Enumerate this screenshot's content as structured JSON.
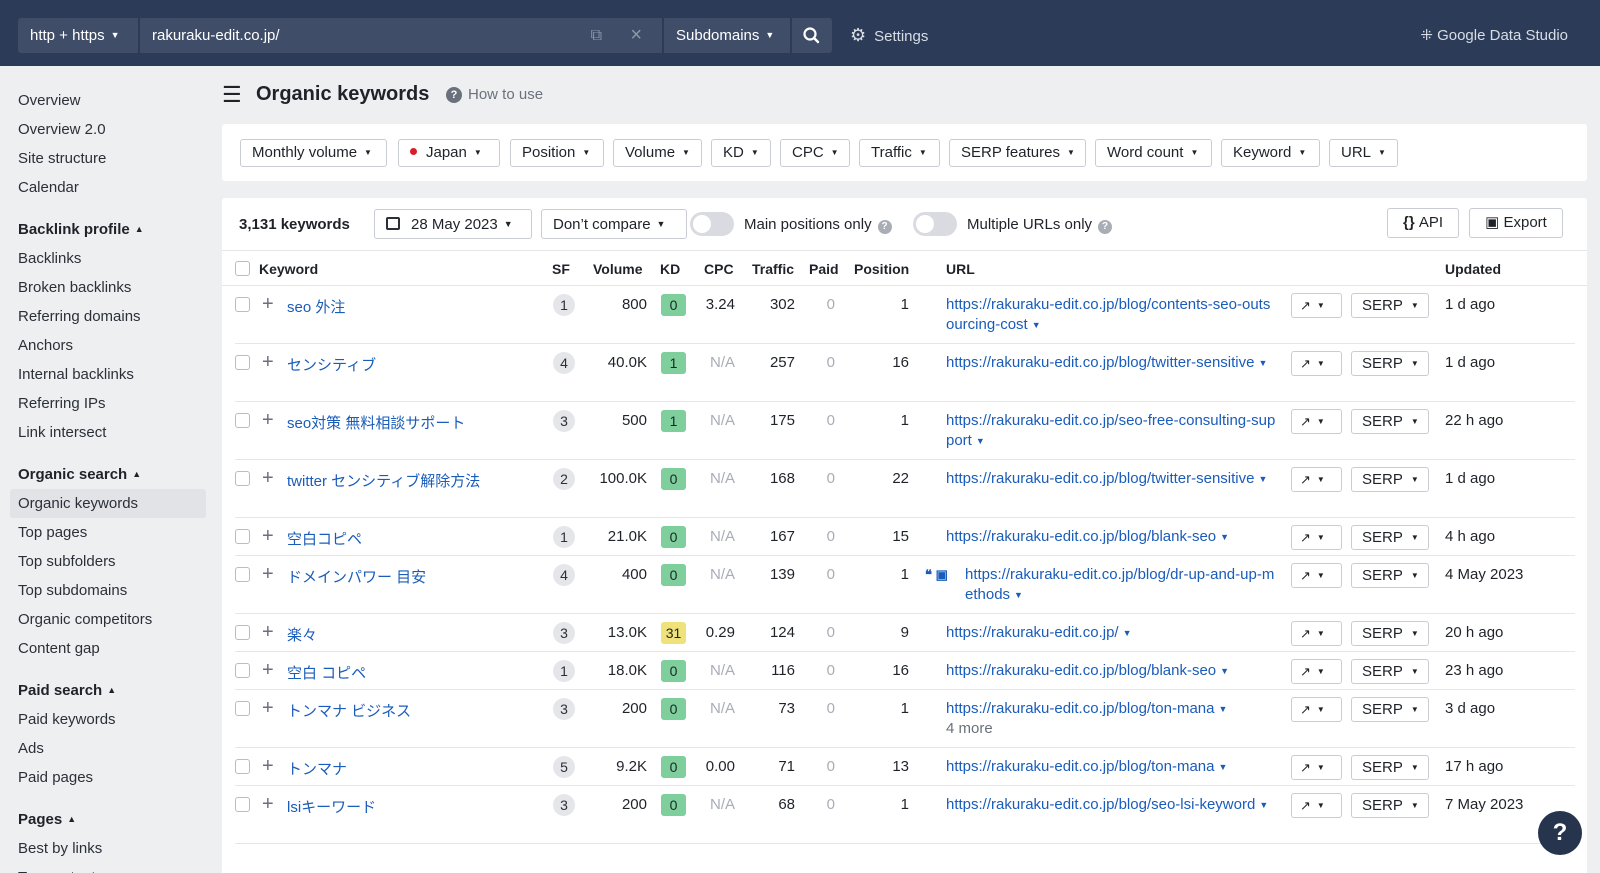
{
  "topbar": {
    "protocol": "http + https",
    "url": "rakuraku-edit.co.jp/",
    "mode": "Subdomains",
    "settings": "Settings",
    "gds": "Google Data Studio"
  },
  "sidebar": {
    "items_top": [
      "Overview",
      "Overview 2.0",
      "Site structure",
      "Calendar"
    ],
    "backlink_title": "Backlink profile",
    "backlink_items": [
      "Backlinks",
      "Broken backlinks",
      "Referring domains",
      "Anchors",
      "Internal backlinks",
      "Referring IPs",
      "Link intersect"
    ],
    "organic_title": "Organic search",
    "organic_items": [
      "Organic keywords",
      "Top pages",
      "Top subfolders",
      "Top subdomains",
      "Organic competitors",
      "Content gap"
    ],
    "paid_title": "Paid search",
    "paid_items": [
      "Paid keywords",
      "Ads",
      "Paid pages"
    ],
    "pages_title": "Pages",
    "pages_items": [
      "Best by links",
      "Top content"
    ]
  },
  "header": {
    "title": "Organic keywords",
    "how_to": "How to use"
  },
  "filters": [
    "Monthly volume",
    "Japan",
    "Position",
    "Volume",
    "KD",
    "CPC",
    "Traffic",
    "SERP features",
    "Word count",
    "Keyword",
    "URL"
  ],
  "toolbar": {
    "count": "3,131 keywords",
    "date": "28 May 2023",
    "compare": "Don’t compare",
    "main_positions": "Main positions only",
    "multiple_urls": "Multiple URLs only",
    "api": "API",
    "export": "Export"
  },
  "columns": [
    "Keyword",
    "SF",
    "Volume",
    "KD",
    "CPC",
    "Traffic",
    "Paid",
    "Position",
    "URL",
    "Updated"
  ],
  "rows": [
    {
      "kw": "seo 外注",
      "sf": "1",
      "vol": "800",
      "kd": "0",
      "kdc": "g",
      "cpc": "3.24",
      "traffic": "302",
      "paid": "0",
      "pos": "1",
      "url": "https://rakuraku-edit.co.jp/blog/contents-seo-outsourcing-cost",
      "more": "",
      "upd": "1 d ago"
    },
    {
      "kw": "センシティブ",
      "sf": "4",
      "vol": "40.0K",
      "kd": "1",
      "kdc": "g",
      "cpc": "N/A",
      "traffic": "257",
      "paid": "0",
      "pos": "16",
      "url": "https://rakuraku-edit.co.jp/blog/twitter-sensitive",
      "more": "",
      "upd": "1 d ago"
    },
    {
      "kw": "seo対策 無料相談サポート",
      "sf": "3",
      "vol": "500",
      "kd": "1",
      "kdc": "g",
      "cpc": "N/A",
      "traffic": "175",
      "paid": "0",
      "pos": "1",
      "url": "https://rakuraku-edit.co.jp/seo-free-consulting-support",
      "more": "",
      "upd": "22 h ago"
    },
    {
      "kw": "twitter センシティブ解除方法",
      "sf": "2",
      "vol": "100.0K",
      "kd": "0",
      "kdc": "g",
      "cpc": "N/A",
      "traffic": "168",
      "paid": "0",
      "pos": "22",
      "url": "https://rakuraku-edit.co.jp/blog/twitter-sensitive",
      "more": "",
      "upd": "1 d ago"
    },
    {
      "kw": "空白コピペ",
      "sf": "1",
      "vol": "21.0K",
      "kd": "0",
      "kdc": "g",
      "cpc": "N/A",
      "traffic": "167",
      "paid": "0",
      "pos": "15",
      "url": "https://rakuraku-edit.co.jp/blog/blank-seo",
      "more": "",
      "upd": "4 h ago"
    },
    {
      "kw": "ドメインパワー 目安",
      "sf": "4",
      "vol": "400",
      "kd": "0",
      "kdc": "g",
      "cpc": "N/A",
      "traffic": "139",
      "paid": "0",
      "pos": "1",
      "url": "https://rakuraku-edit.co.jp/blog/dr-up-and-up-methods",
      "more": "",
      "upd": "4 May 2023",
      "icons": true
    },
    {
      "kw": "楽々",
      "sf": "3",
      "vol": "13.0K",
      "kd": "31",
      "kdc": "y",
      "cpc": "0.29",
      "traffic": "124",
      "paid": "0",
      "pos": "9",
      "url": "https://rakuraku-edit.co.jp/",
      "more": "",
      "upd": "20 h ago"
    },
    {
      "kw": "空白 コピペ",
      "sf": "1",
      "vol": "18.0K",
      "kd": "0",
      "kdc": "g",
      "cpc": "N/A",
      "traffic": "116",
      "paid": "0",
      "pos": "16",
      "url": "https://rakuraku-edit.co.jp/blog/blank-seo",
      "more": "",
      "upd": "23 h ago"
    },
    {
      "kw": "トンマナ ビジネス",
      "sf": "3",
      "vol": "200",
      "kd": "0",
      "kdc": "g",
      "cpc": "N/A",
      "traffic": "73",
      "paid": "0",
      "pos": "1",
      "url": "https://rakuraku-edit.co.jp/blog/ton-mana",
      "more": "4 more",
      "upd": "3 d ago"
    },
    {
      "kw": "トンマナ",
      "sf": "5",
      "vol": "9.2K",
      "kd": "0",
      "kdc": "g",
      "cpc": "0.00",
      "traffic": "71",
      "paid": "0",
      "pos": "13",
      "url": "https://rakuraku-edit.co.jp/blog/ton-mana",
      "more": "",
      "upd": "17 h ago"
    },
    {
      "kw": "lsiキーワード",
      "sf": "3",
      "vol": "200",
      "kd": "0",
      "kdc": "g",
      "cpc": "N/A",
      "traffic": "68",
      "paid": "0",
      "pos": "1",
      "url": "https://rakuraku-edit.co.jp/blog/seo-lsi-keyword",
      "more": "",
      "upd": "7 May 2023"
    }
  ],
  "row_buttons": {
    "serp": "SERP"
  },
  "help": "?",
  "icons": {
    "search": "search-icon",
    "gear": "gear-icon",
    "calendar": "calendar-icon",
    "trend": "trend-icon",
    "menu": "hamburger-icon"
  },
  "colors": {
    "topbar": "#2c3b57",
    "link": "#1a5cba",
    "kd_green": "#7fcf9c",
    "kd_yellow": "#efe27a"
  }
}
